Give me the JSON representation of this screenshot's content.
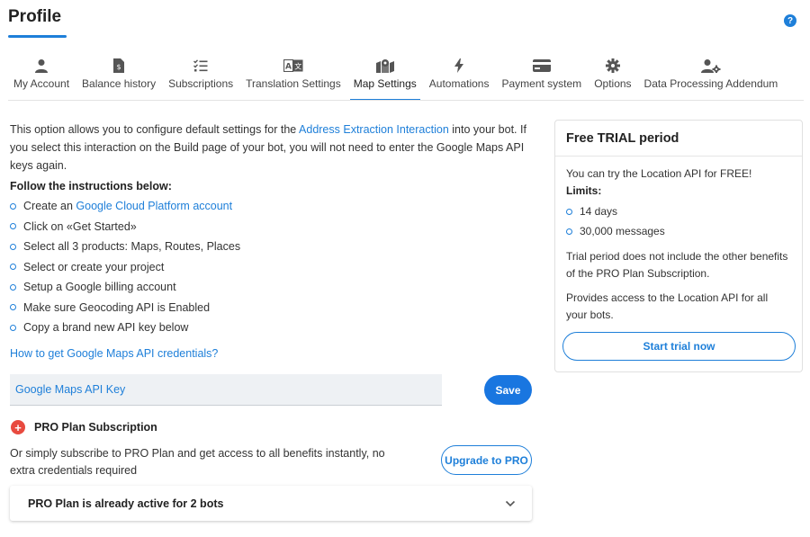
{
  "header": {
    "title": "Profile",
    "help_icon": "?"
  },
  "tabs": [
    {
      "label": "My Account",
      "icon": "user-icon"
    },
    {
      "label": "Balance history",
      "icon": "invoice-icon"
    },
    {
      "label": "Subscriptions",
      "icon": "checklist-icon"
    },
    {
      "label": "Translation Settings",
      "icon": "translate-icon"
    },
    {
      "label": "Map Settings",
      "icon": "map-icon",
      "active": true
    },
    {
      "label": "Automations",
      "icon": "bolt-icon"
    },
    {
      "label": "Payment system",
      "icon": "credit-card-icon"
    },
    {
      "label": "Options",
      "icon": "gear-icon"
    },
    {
      "label": "Data Processing Addendum",
      "icon": "user-gear-icon"
    }
  ],
  "intro": {
    "before": "This option allows you to configure default settings for the ",
    "link": "Address Extraction Interaction",
    "after": " into your bot. If you select this interaction on the Build page of your bot, you will not need to enter the Google Maps API keys again."
  },
  "instructions": {
    "title": "Follow the instructions below:",
    "step1_before": "Create an ",
    "step1_link": "Google Cloud Platform account",
    "steps": [
      "Click on «Get Started»",
      "Select all 3 products: Maps, Routes, Places",
      "Select or create your project",
      "Setup a Google billing account",
      "Make sure Geocoding API is Enabled",
      "Copy a brand new API key below"
    ]
  },
  "how_link": "How to get Google Maps API credentials?",
  "api_key": {
    "placeholder": "Google Maps API Key",
    "value": ""
  },
  "save_label": "Save",
  "pro": {
    "badge": "+",
    "title": "PRO Plan Subscription",
    "description": "Or simply subscribe to PRO Plan and get access to all benefits instantly, no extra credentials required",
    "upgrade_label": "Upgrade to PRO",
    "accordion_label": "PRO Plan is already active for 2 bots"
  },
  "trial": {
    "title": "Free TRIAL period",
    "intro": "You can try the Location API for FREE!",
    "limits_label": "Limits:",
    "limits": [
      "14 days",
      "30,000 messages"
    ],
    "note1": "Trial period does not include the other benefits of the PRO Plan Subscription.",
    "note2": "Provides access to the Location API for all your bots.",
    "button_label": "Start trial now"
  },
  "colors": {
    "accent": "#1e7fd9",
    "pro_badge": "#e84a3f"
  }
}
